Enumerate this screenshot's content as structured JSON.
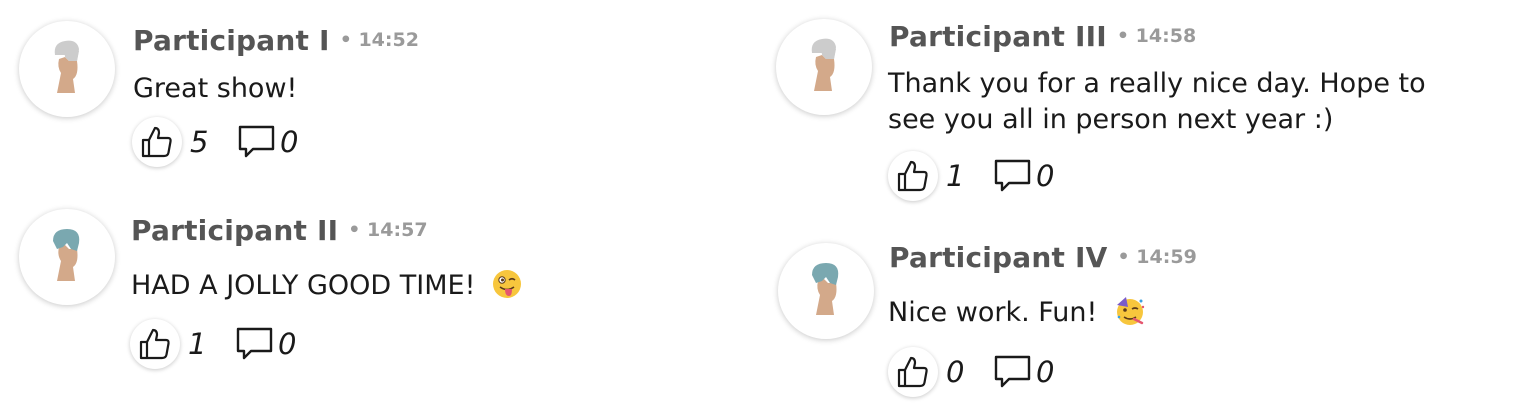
{
  "colors": {
    "name": "#555555",
    "time": "#9a9a9a",
    "text": "#1a1a1a",
    "skin": "#d3a98a",
    "hair_grey": "#cccccc",
    "hair_teal": "#7aa8b0"
  },
  "comments": [
    {
      "author": "Participant I",
      "time": "• 14:52",
      "text": "Great show!",
      "emoji": "",
      "likes": "5",
      "replies": "0",
      "avatar_icon": "participant-grey-hair-avatar"
    },
    {
      "author": "Participant II",
      "time": "• 14:57",
      "text": "HAD A JOLLY GOOD TIME!",
      "emoji": "winking-face-with-tongue",
      "likes": "1",
      "replies": "0",
      "avatar_icon": "participant-teal-hair-avatar"
    },
    {
      "author": "Participant III",
      "time": "• 14:58",
      "text_lines": [
        "Thank you for a really nice day. Hope to",
        "see you all in person next year :)"
      ],
      "likes": "1",
      "replies": "0",
      "avatar_icon": "participant-grey-hair-avatar"
    },
    {
      "author": "Participant IV",
      "time": "• 14:59",
      "text": "Nice work. Fun!",
      "emoji": "partying-face",
      "likes": "0",
      "replies": "0",
      "avatar_icon": "participant-teal-hair-avatar"
    }
  ],
  "icons": {
    "like": "thumbs-up-icon",
    "reply": "speech-bubble-icon"
  }
}
